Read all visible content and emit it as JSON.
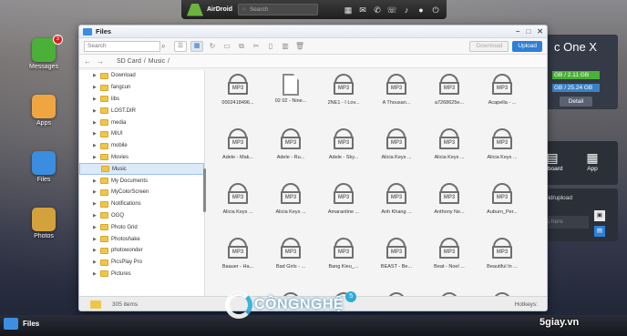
{
  "topbar": {
    "brand": "AirDroid",
    "search_placeholder": "Search",
    "icons": [
      "apps-icon",
      "mail-icon",
      "phone-icon",
      "call-icon",
      "notification-icon",
      "user-icon",
      "power-icon"
    ]
  },
  "desktop": {
    "icons": [
      {
        "label": "Messages",
        "badge": "3",
        "color": "#4ab037"
      },
      {
        "label": "Apps",
        "color": "#f0a640"
      },
      {
        "label": "Files",
        "color": "#3b8de0"
      },
      {
        "label": "Photos",
        "color": "#d4a23c"
      }
    ]
  },
  "device_panel": {
    "title": "c One X",
    "storage1": "GB / 2.11 GB",
    "storage2": "GB / 25.24 GB",
    "detail": "Detail"
  },
  "tools_panel": {
    "clipboard": "lipboard",
    "app": "App"
  },
  "upload_panel": {
    "title": "oid/upload",
    "hint": "lders here"
  },
  "taskbar": {
    "label": "Files"
  },
  "window": {
    "title": "Files",
    "search_placeholder": "Search",
    "download": "Download",
    "upload": "Upload",
    "path": [
      "SD Card",
      "/",
      "Music",
      "/"
    ],
    "tree": [
      {
        "name": "Download",
        "sel": false
      },
      {
        "name": "fangcun",
        "sel": false
      },
      {
        "name": "libs",
        "sel": false
      },
      {
        "name": "LOST.DIR",
        "sel": false
      },
      {
        "name": "media",
        "sel": false
      },
      {
        "name": "MIUI",
        "sel": false
      },
      {
        "name": "mobile",
        "sel": false
      },
      {
        "name": "Movies",
        "sel": false
      },
      {
        "name": "Music",
        "sel": true
      },
      {
        "name": "My Documents",
        "sel": false
      },
      {
        "name": "MyColorScreen",
        "sel": false
      },
      {
        "name": "Notifications",
        "sel": false
      },
      {
        "name": "OGQ",
        "sel": false
      },
      {
        "name": "Photo Grid",
        "sel": false
      },
      {
        "name": "Photoshake",
        "sel": false
      },
      {
        "name": "photowonder",
        "sel": false
      },
      {
        "name": "PicsPlay Pro",
        "sel": false
      },
      {
        "name": "Pictures",
        "sel": false
      }
    ],
    "files": [
      {
        "name": "0002418496...",
        "type": "mp3"
      },
      {
        "name": "02 02 - Nine...",
        "type": "doc"
      },
      {
        "name": "2NE1 - I Lov...",
        "type": "mp3"
      },
      {
        "name": "A Thousan...",
        "type": "mp3"
      },
      {
        "name": "a7268625e...",
        "type": "mp3"
      },
      {
        "name": "Acapella - ...",
        "type": "mp3"
      },
      {
        "name": "Adele - Mak...",
        "type": "mp3"
      },
      {
        "name": "Adele - Ru...",
        "type": "mp3"
      },
      {
        "name": "Adele - Sky...",
        "type": "mp3"
      },
      {
        "name": "Alicia Keys ...",
        "type": "mp3"
      },
      {
        "name": "Alicia Keys ...",
        "type": "mp3"
      },
      {
        "name": "Alicia Keys ...",
        "type": "mp3"
      },
      {
        "name": "Alicia Keys ...",
        "type": "mp3"
      },
      {
        "name": "Alicia Keys ...",
        "type": "mp3"
      },
      {
        "name": "Amarantine ...",
        "type": "mp3"
      },
      {
        "name": "Anh Khang ...",
        "type": "mp3"
      },
      {
        "name": "Anthony Ne...",
        "type": "mp3"
      },
      {
        "name": "Auburn_Per...",
        "type": "mp3"
      },
      {
        "name": "Baauer - Ha...",
        "type": "mp3"
      },
      {
        "name": "Bad Girls - ...",
        "type": "mp3"
      },
      {
        "name": "Bang Kieu_...",
        "type": "mp3"
      },
      {
        "name": "BEAST - Be...",
        "type": "mp3"
      },
      {
        "name": "Beat - Noel ...",
        "type": "mp3"
      },
      {
        "name": "Beautiful In ...",
        "type": "mp3"
      },
      {
        "name": "",
        "type": "mp3"
      },
      {
        "name": "",
        "type": "mp3"
      },
      {
        "name": "",
        "type": "mp3"
      },
      {
        "name": "",
        "type": "mp3"
      },
      {
        "name": "",
        "type": "mp3"
      },
      {
        "name": "",
        "type": "mp3"
      }
    ],
    "item_count": "305 items",
    "hotkeys": "Hotkeys:"
  },
  "watermark": {
    "text": "CÔNGNGHỆ",
    "num": "5"
  },
  "site": "5giay.vn"
}
